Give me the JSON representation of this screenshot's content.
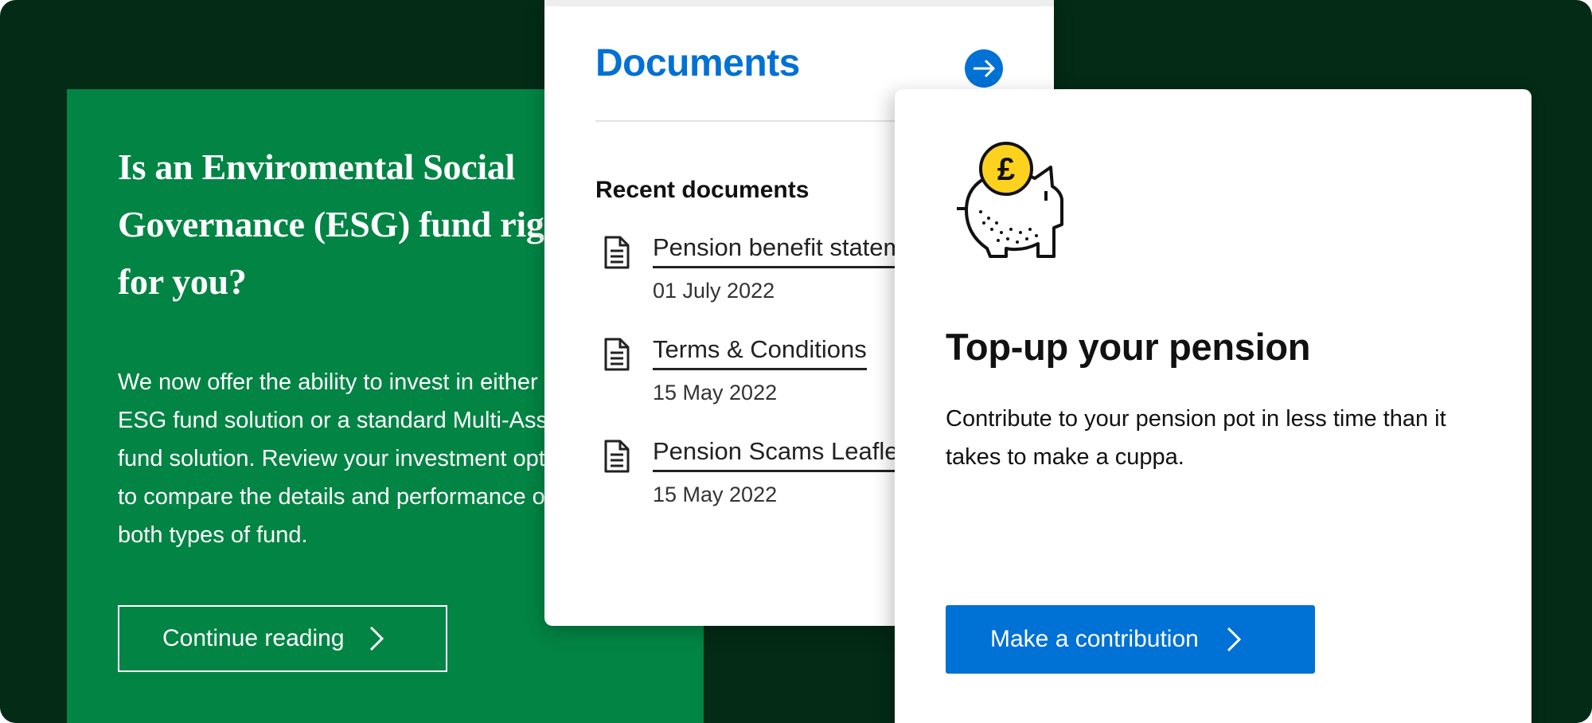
{
  "esg_card": {
    "heading": "Is an Enviromental Social Governance (ESG)  fund right for you?",
    "body": "We now offer the ability to invest in either an ESG fund solution or a standard Multi-Asset fund solution. Review your investment options to compare the details and performance of both types of fund.",
    "button_label": "Continue reading"
  },
  "documents_card": {
    "title": "Documents",
    "subheading": "Recent documents",
    "items": [
      {
        "title": "Pension benefit statement",
        "date": "01 July 2022"
      },
      {
        "title": "Terms & Conditions",
        "date": "15 May 2022"
      },
      {
        "title": "Pension Scams Leaflet",
        "date": "15 May 2022"
      }
    ]
  },
  "topup_card": {
    "heading": "Top-up your pension",
    "body": "Contribute to your pension pot in less time than it takes to make a cuppa.",
    "button_label": "Make a contribution",
    "coin_symbol": "£"
  },
  "colors": {
    "background": "#032b16",
    "esg_green": "#028444",
    "primary_blue": "#0071d5",
    "coin_yellow": "#fdd21f"
  }
}
